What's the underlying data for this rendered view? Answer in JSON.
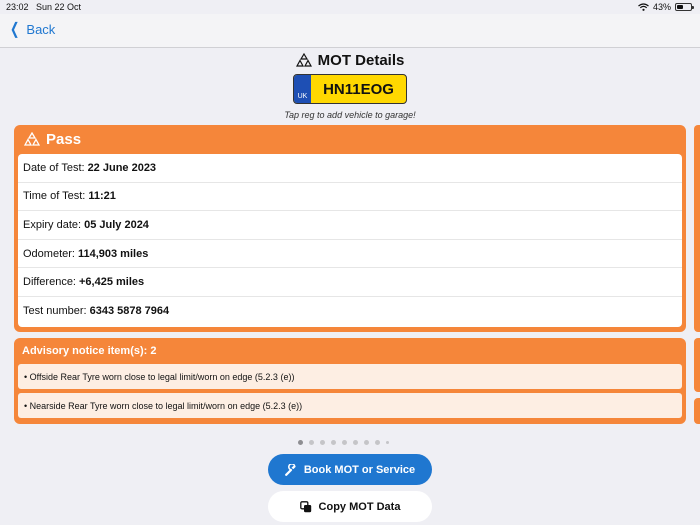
{
  "status_bar": {
    "time": "23:02",
    "date": "Sun 22 Oct",
    "battery": "43%",
    "battery_level": 0.43
  },
  "nav": {
    "back_label": "Back"
  },
  "page": {
    "title": "MOT Details",
    "plate_country": "UK",
    "registration": "HN11EOG",
    "hint": "Tap reg to add vehicle to garage!"
  },
  "result": {
    "status": "Pass",
    "rows": [
      {
        "label": "Date of Test:",
        "value": "22 June 2023"
      },
      {
        "label": "Time of Test:",
        "value": "11:21"
      },
      {
        "label": "Expiry date:",
        "value": "05 July 2024"
      },
      {
        "label": "Odometer:",
        "value": "114,903 miles"
      },
      {
        "label": "Difference:",
        "value": "+6,425 miles"
      },
      {
        "label": "Test number:",
        "value": "6343 5878 7964"
      }
    ]
  },
  "advisory": {
    "header": "Advisory notice item(s): 2",
    "items": [
      "• Offside Rear Tyre worn close to legal limit/worn on edge (5.2.3 (e))",
      "• Nearside Rear Tyre worn close to legal limit/worn on edge (5.2.3 (e))"
    ]
  },
  "pager": {
    "current": 1
  },
  "actions": {
    "book_label": "Book MOT or Service",
    "copy_label": "Copy MOT Data"
  },
  "colors": {
    "accent": "#f5863a",
    "primary": "#1f77d0",
    "plate": "#ffd800"
  }
}
